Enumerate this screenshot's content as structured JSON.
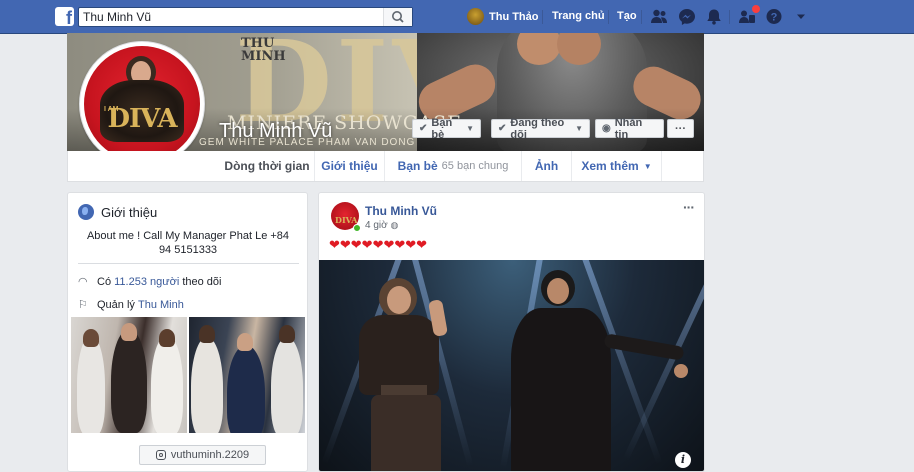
{
  "topbar": {
    "search_value": "Thu Minh Vũ",
    "user_name": "Thu Thảo",
    "home_label": "Trang chủ",
    "create_label": "Tạo",
    "brand_color": "#4267b2",
    "icons": [
      "friend-requests-icon",
      "messenger-icon",
      "notifications-icon",
      "friends-badge-icon",
      "help-icon",
      "dropdown-icon"
    ]
  },
  "profile": {
    "name": "Thu Minh Vũ",
    "cover_small": "THU\nMINH",
    "cover_big": "DIVA",
    "cover_showcase": "MINIERE SHOWCASE",
    "cover_sub": "GEM WHITE PALACE PHAM VAN DONG",
    "pic_small": "I AM",
    "pic_diva": "DIVA",
    "buttons": {
      "friends": "Bạn bè",
      "following": "Đang theo dõi",
      "message": "Nhắn tin",
      "more": "···"
    }
  },
  "tabs": [
    {
      "label": "Dòng thời gian",
      "active": true
    },
    {
      "label": "Giới thiệu"
    },
    {
      "label": "Bạn bè",
      "sub": "65 bạn chung"
    },
    {
      "label": "Ảnh"
    },
    {
      "label": "Xem thêm"
    }
  ],
  "intro": {
    "title": "Giới thiệu",
    "bio": "About me ! Call My Manager Phat Le +84 94 5151333",
    "followers_prefix": "Có",
    "followers_count": "11.253 người",
    "followers_suffix": "theo dõi",
    "managed_prefix": "Quản lý",
    "managed_page": "Thu Minh",
    "instagram": "vuthuminh.2209"
  },
  "post": {
    "author": "Thu Minh Vũ",
    "time": "4 giờ",
    "text": "❤❤❤❤❤❤❤❤❤",
    "menu": "···",
    "info": "i"
  }
}
